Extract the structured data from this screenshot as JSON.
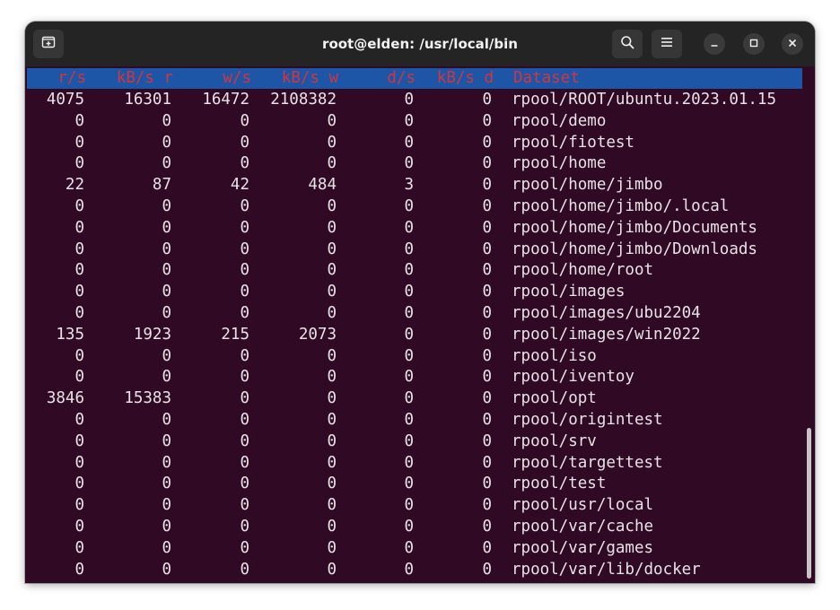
{
  "window": {
    "title": "root@elden: /usr/local/bin"
  },
  "icons": {
    "new_tab": "new-tab-icon",
    "search": "search-icon",
    "menu": "hamburger-menu-icon",
    "minimize": "minimize-icon",
    "maximize": "maximize-icon",
    "close": "close-icon"
  },
  "colors": {
    "terminal_bg": "#300a24",
    "header_bg": "#1d56a6",
    "header_text": "#d1353f",
    "text": "#e8e2e6",
    "titlebar_bg": "#242424"
  },
  "table": {
    "headers": [
      "r/s",
      "kB/s r",
      "w/s",
      "kB/s w",
      "d/s",
      "kB/s d",
      "Dataset"
    ],
    "rows": [
      [
        "4075",
        "16301",
        "16472",
        "2108382",
        "0",
        "0",
        "rpool/ROOT/ubuntu.2023.01.15"
      ],
      [
        "0",
        "0",
        "0",
        "0",
        "0",
        "0",
        "rpool/demo"
      ],
      [
        "0",
        "0",
        "0",
        "0",
        "0",
        "0",
        "rpool/fiotest"
      ],
      [
        "0",
        "0",
        "0",
        "0",
        "0",
        "0",
        "rpool/home"
      ],
      [
        "22",
        "87",
        "42",
        "484",
        "3",
        "0",
        "rpool/home/jimbo"
      ],
      [
        "0",
        "0",
        "0",
        "0",
        "0",
        "0",
        "rpool/home/jimbo/.local"
      ],
      [
        "0",
        "0",
        "0",
        "0",
        "0",
        "0",
        "rpool/home/jimbo/Documents"
      ],
      [
        "0",
        "0",
        "0",
        "0",
        "0",
        "0",
        "rpool/home/jimbo/Downloads"
      ],
      [
        "0",
        "0",
        "0",
        "0",
        "0",
        "0",
        "rpool/home/root"
      ],
      [
        "0",
        "0",
        "0",
        "0",
        "0",
        "0",
        "rpool/images"
      ],
      [
        "0",
        "0",
        "0",
        "0",
        "0",
        "0",
        "rpool/images/ubu2204"
      ],
      [
        "135",
        "1923",
        "215",
        "2073",
        "0",
        "0",
        "rpool/images/win2022"
      ],
      [
        "0",
        "0",
        "0",
        "0",
        "0",
        "0",
        "rpool/iso"
      ],
      [
        "0",
        "0",
        "0",
        "0",
        "0",
        "0",
        "rpool/iventoy"
      ],
      [
        "3846",
        "15383",
        "0",
        "0",
        "0",
        "0",
        "rpool/opt"
      ],
      [
        "0",
        "0",
        "0",
        "0",
        "0",
        "0",
        "rpool/origintest"
      ],
      [
        "0",
        "0",
        "0",
        "0",
        "0",
        "0",
        "rpool/srv"
      ],
      [
        "0",
        "0",
        "0",
        "0",
        "0",
        "0",
        "rpool/targettest"
      ],
      [
        "0",
        "0",
        "0",
        "0",
        "0",
        "0",
        "rpool/test"
      ],
      [
        "0",
        "0",
        "0",
        "0",
        "0",
        "0",
        "rpool/usr/local"
      ],
      [
        "0",
        "0",
        "0",
        "0",
        "0",
        "0",
        "rpool/var/cache"
      ],
      [
        "0",
        "0",
        "0",
        "0",
        "0",
        "0",
        "rpool/var/games"
      ],
      [
        "0",
        "0",
        "0",
        "0",
        "0",
        "0",
        "rpool/var/lib/docker"
      ]
    ]
  }
}
